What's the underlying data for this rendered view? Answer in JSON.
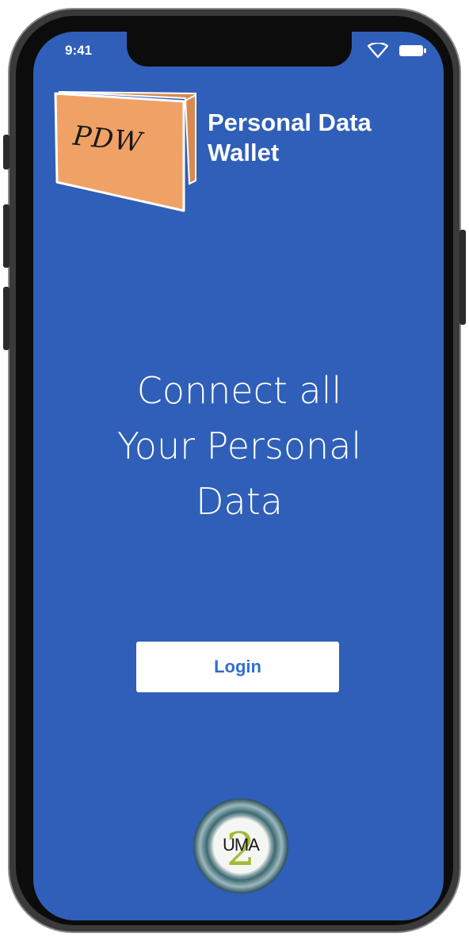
{
  "status_bar": {
    "time": "9:41"
  },
  "header": {
    "logo_text": "PDW",
    "app_name_line1": "Personal Data",
    "app_name_line2": "Wallet"
  },
  "hero": {
    "line1": "Connect all",
    "line2": "Your Personal",
    "line3": "Data"
  },
  "login_button": {
    "label": "Login"
  },
  "footer_logo": {
    "text": "UMA",
    "accent_digit": "2"
  },
  "colors": {
    "screen_background": "#2f5fb8",
    "logo_orange": "#f0a266",
    "button_text": "#2f6fd0",
    "uma_accent": "#a8b83a"
  }
}
